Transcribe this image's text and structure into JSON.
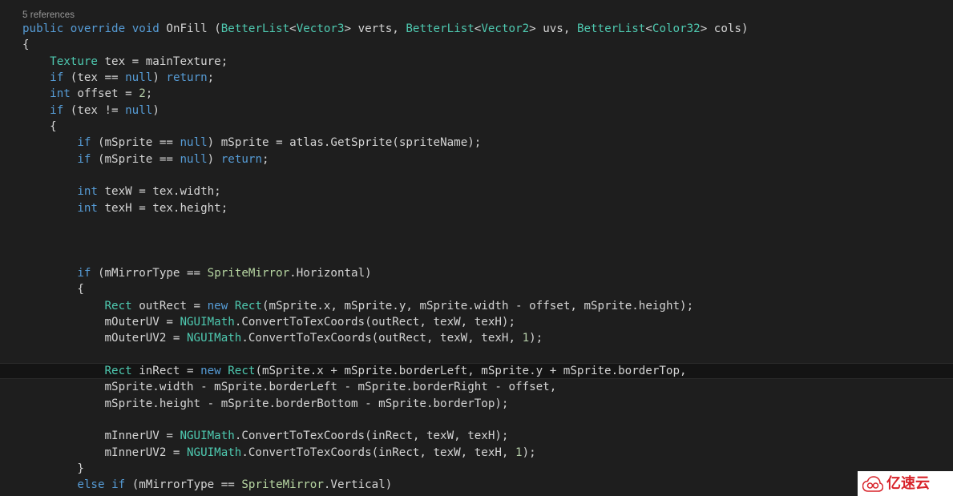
{
  "editor": {
    "background_color": "#1e1e1e",
    "current_line_color": "#141414",
    "codelens": "5 references",
    "language": "csharp",
    "colors": {
      "keyword": "#569cd6",
      "type": "#4ec9b0",
      "enum": "#b8d7a3",
      "number": "#b5cea8",
      "plain": "#d4d4d4",
      "codelens": "#9a9a9a"
    }
  },
  "watermark": {
    "text": "亿速云",
    "logo_color": "#d8232a",
    "background": "#ffffff"
  },
  "code_lines": [
    {
      "n": 1,
      "current": false,
      "tokens": [
        {
          "t": "public",
          "c": "kw"
        },
        {
          "t": " ",
          "c": "id"
        },
        {
          "t": "override",
          "c": "kw"
        },
        {
          "t": " ",
          "c": "id"
        },
        {
          "t": "void",
          "c": "kw"
        },
        {
          "t": " OnFill (",
          "c": "id"
        },
        {
          "t": "BetterList",
          "c": "type"
        },
        {
          "t": "<",
          "c": "id"
        },
        {
          "t": "Vector3",
          "c": "type"
        },
        {
          "t": "> verts, ",
          "c": "id"
        },
        {
          "t": "BetterList",
          "c": "type"
        },
        {
          "t": "<",
          "c": "id"
        },
        {
          "t": "Vector2",
          "c": "type"
        },
        {
          "t": "> uvs, ",
          "c": "id"
        },
        {
          "t": "BetterList",
          "c": "type"
        },
        {
          "t": "<",
          "c": "id"
        },
        {
          "t": "Color32",
          "c": "type"
        },
        {
          "t": "> cols)",
          "c": "id"
        }
      ]
    },
    {
      "n": 2,
      "current": false,
      "tokens": [
        {
          "t": "{",
          "c": "id"
        }
      ]
    },
    {
      "n": 3,
      "current": false,
      "tokens": [
        {
          "t": "    ",
          "c": "id"
        },
        {
          "t": "Texture",
          "c": "type"
        },
        {
          "t": " tex = mainTexture;",
          "c": "id"
        }
      ]
    },
    {
      "n": 4,
      "current": false,
      "tokens": [
        {
          "t": "    ",
          "c": "id"
        },
        {
          "t": "if",
          "c": "kw"
        },
        {
          "t": " (tex == ",
          "c": "id"
        },
        {
          "t": "null",
          "c": "kw"
        },
        {
          "t": ") ",
          "c": "id"
        },
        {
          "t": "return",
          "c": "kw"
        },
        {
          "t": ";",
          "c": "id"
        }
      ]
    },
    {
      "n": 5,
      "current": false,
      "tokens": [
        {
          "t": "    ",
          "c": "id"
        },
        {
          "t": "int",
          "c": "kw"
        },
        {
          "t": " offset = ",
          "c": "id"
        },
        {
          "t": "2",
          "c": "num"
        },
        {
          "t": ";",
          "c": "id"
        }
      ]
    },
    {
      "n": 6,
      "current": false,
      "tokens": [
        {
          "t": "    ",
          "c": "id"
        },
        {
          "t": "if",
          "c": "kw"
        },
        {
          "t": " (tex != ",
          "c": "id"
        },
        {
          "t": "null",
          "c": "kw"
        },
        {
          "t": ")",
          "c": "id"
        }
      ]
    },
    {
      "n": 7,
      "current": false,
      "tokens": [
        {
          "t": "    {",
          "c": "id"
        }
      ]
    },
    {
      "n": 8,
      "current": false,
      "tokens": [
        {
          "t": "        ",
          "c": "id"
        },
        {
          "t": "if",
          "c": "kw"
        },
        {
          "t": " (mSprite == ",
          "c": "id"
        },
        {
          "t": "null",
          "c": "kw"
        },
        {
          "t": ") mSprite = atlas.GetSprite(spriteName);",
          "c": "id"
        }
      ]
    },
    {
      "n": 9,
      "current": false,
      "tokens": [
        {
          "t": "        ",
          "c": "id"
        },
        {
          "t": "if",
          "c": "kw"
        },
        {
          "t": " (mSprite == ",
          "c": "id"
        },
        {
          "t": "null",
          "c": "kw"
        },
        {
          "t": ") ",
          "c": "id"
        },
        {
          "t": "return",
          "c": "kw"
        },
        {
          "t": ";",
          "c": "id"
        }
      ]
    },
    {
      "n": 10,
      "current": false,
      "tokens": [
        {
          "t": "",
          "c": "id"
        }
      ]
    },
    {
      "n": 11,
      "current": false,
      "tokens": [
        {
          "t": "        ",
          "c": "id"
        },
        {
          "t": "int",
          "c": "kw"
        },
        {
          "t": " texW = tex.width;",
          "c": "id"
        }
      ]
    },
    {
      "n": 12,
      "current": false,
      "tokens": [
        {
          "t": "        ",
          "c": "id"
        },
        {
          "t": "int",
          "c": "kw"
        },
        {
          "t": " texH = tex.height;",
          "c": "id"
        }
      ]
    },
    {
      "n": 13,
      "current": false,
      "tokens": [
        {
          "t": "",
          "c": "id"
        }
      ]
    },
    {
      "n": 14,
      "current": false,
      "tokens": [
        {
          "t": "",
          "c": "id"
        }
      ]
    },
    {
      "n": 15,
      "current": false,
      "tokens": [
        {
          "t": "",
          "c": "id"
        }
      ]
    },
    {
      "n": 16,
      "current": false,
      "tokens": [
        {
          "t": "        ",
          "c": "id"
        },
        {
          "t": "if",
          "c": "kw"
        },
        {
          "t": " (mMirrorType == ",
          "c": "id"
        },
        {
          "t": "SpriteMirror",
          "c": "enum"
        },
        {
          "t": ".Horizontal)",
          "c": "id"
        }
      ]
    },
    {
      "n": 17,
      "current": false,
      "tokens": [
        {
          "t": "        {",
          "c": "id"
        }
      ]
    },
    {
      "n": 18,
      "current": false,
      "tokens": [
        {
          "t": "            ",
          "c": "id"
        },
        {
          "t": "Rect",
          "c": "type"
        },
        {
          "t": " outRect = ",
          "c": "id"
        },
        {
          "t": "new",
          "c": "kw"
        },
        {
          "t": " ",
          "c": "id"
        },
        {
          "t": "Rect",
          "c": "type"
        },
        {
          "t": "(mSprite.x, mSprite.y, mSprite.width - offset, mSprite.height);",
          "c": "id"
        }
      ]
    },
    {
      "n": 19,
      "current": false,
      "tokens": [
        {
          "t": "            mOuterUV = ",
          "c": "id"
        },
        {
          "t": "NGUIMath",
          "c": "type"
        },
        {
          "t": ".ConvertToTexCoords(outRect, texW, texH);",
          "c": "id"
        }
      ]
    },
    {
      "n": 20,
      "current": false,
      "tokens": [
        {
          "t": "            mOuterUV2 = ",
          "c": "id"
        },
        {
          "t": "NGUIMath",
          "c": "type"
        },
        {
          "t": ".ConvertToTexCoords(outRect, texW, texH, ",
          "c": "id"
        },
        {
          "t": "1",
          "c": "num"
        },
        {
          "t": ");",
          "c": "id"
        }
      ]
    },
    {
      "n": 21,
      "current": false,
      "tokens": [
        {
          "t": "",
          "c": "id"
        }
      ]
    },
    {
      "n": 22,
      "current": true,
      "tokens": [
        {
          "t": "            ",
          "c": "id"
        },
        {
          "t": "Rect",
          "c": "type"
        },
        {
          "t": " inRect = ",
          "c": "id"
        },
        {
          "t": "new",
          "c": "kw"
        },
        {
          "t": " ",
          "c": "id"
        },
        {
          "t": "Rect",
          "c": "type"
        },
        {
          "t": "(mSprite.x + mSprite.borderLeft, mSprite.y + mSprite.borderTop,",
          "c": "id"
        }
      ]
    },
    {
      "n": 23,
      "current": false,
      "tokens": [
        {
          "t": "            mSprite.width - mSprite.borderLeft - mSprite.borderRight - offset,",
          "c": "id"
        }
      ]
    },
    {
      "n": 24,
      "current": false,
      "tokens": [
        {
          "t": "            mSprite.height - mSprite.borderBottom - mSprite.borderTop);",
          "c": "id"
        }
      ]
    },
    {
      "n": 25,
      "current": false,
      "tokens": [
        {
          "t": "",
          "c": "id"
        }
      ]
    },
    {
      "n": 26,
      "current": false,
      "tokens": [
        {
          "t": "            mInnerUV = ",
          "c": "id"
        },
        {
          "t": "NGUIMath",
          "c": "type"
        },
        {
          "t": ".ConvertToTexCoords(inRect, texW, texH);",
          "c": "id"
        }
      ]
    },
    {
      "n": 27,
      "current": false,
      "tokens": [
        {
          "t": "            mInnerUV2 = ",
          "c": "id"
        },
        {
          "t": "NGUIMath",
          "c": "type"
        },
        {
          "t": ".ConvertToTexCoords(inRect, texW, texH, ",
          "c": "id"
        },
        {
          "t": "1",
          "c": "num"
        },
        {
          "t": ");",
          "c": "id"
        }
      ]
    },
    {
      "n": 28,
      "current": false,
      "tokens": [
        {
          "t": "        }",
          "c": "id"
        }
      ]
    },
    {
      "n": 29,
      "current": false,
      "tokens": [
        {
          "t": "        ",
          "c": "id"
        },
        {
          "t": "else",
          "c": "kw"
        },
        {
          "t": " ",
          "c": "id"
        },
        {
          "t": "if",
          "c": "kw"
        },
        {
          "t": " (mMirrorType == ",
          "c": "id"
        },
        {
          "t": "SpriteMirror",
          "c": "enum"
        },
        {
          "t": ".Vertical)",
          "c": "id"
        }
      ]
    }
  ]
}
